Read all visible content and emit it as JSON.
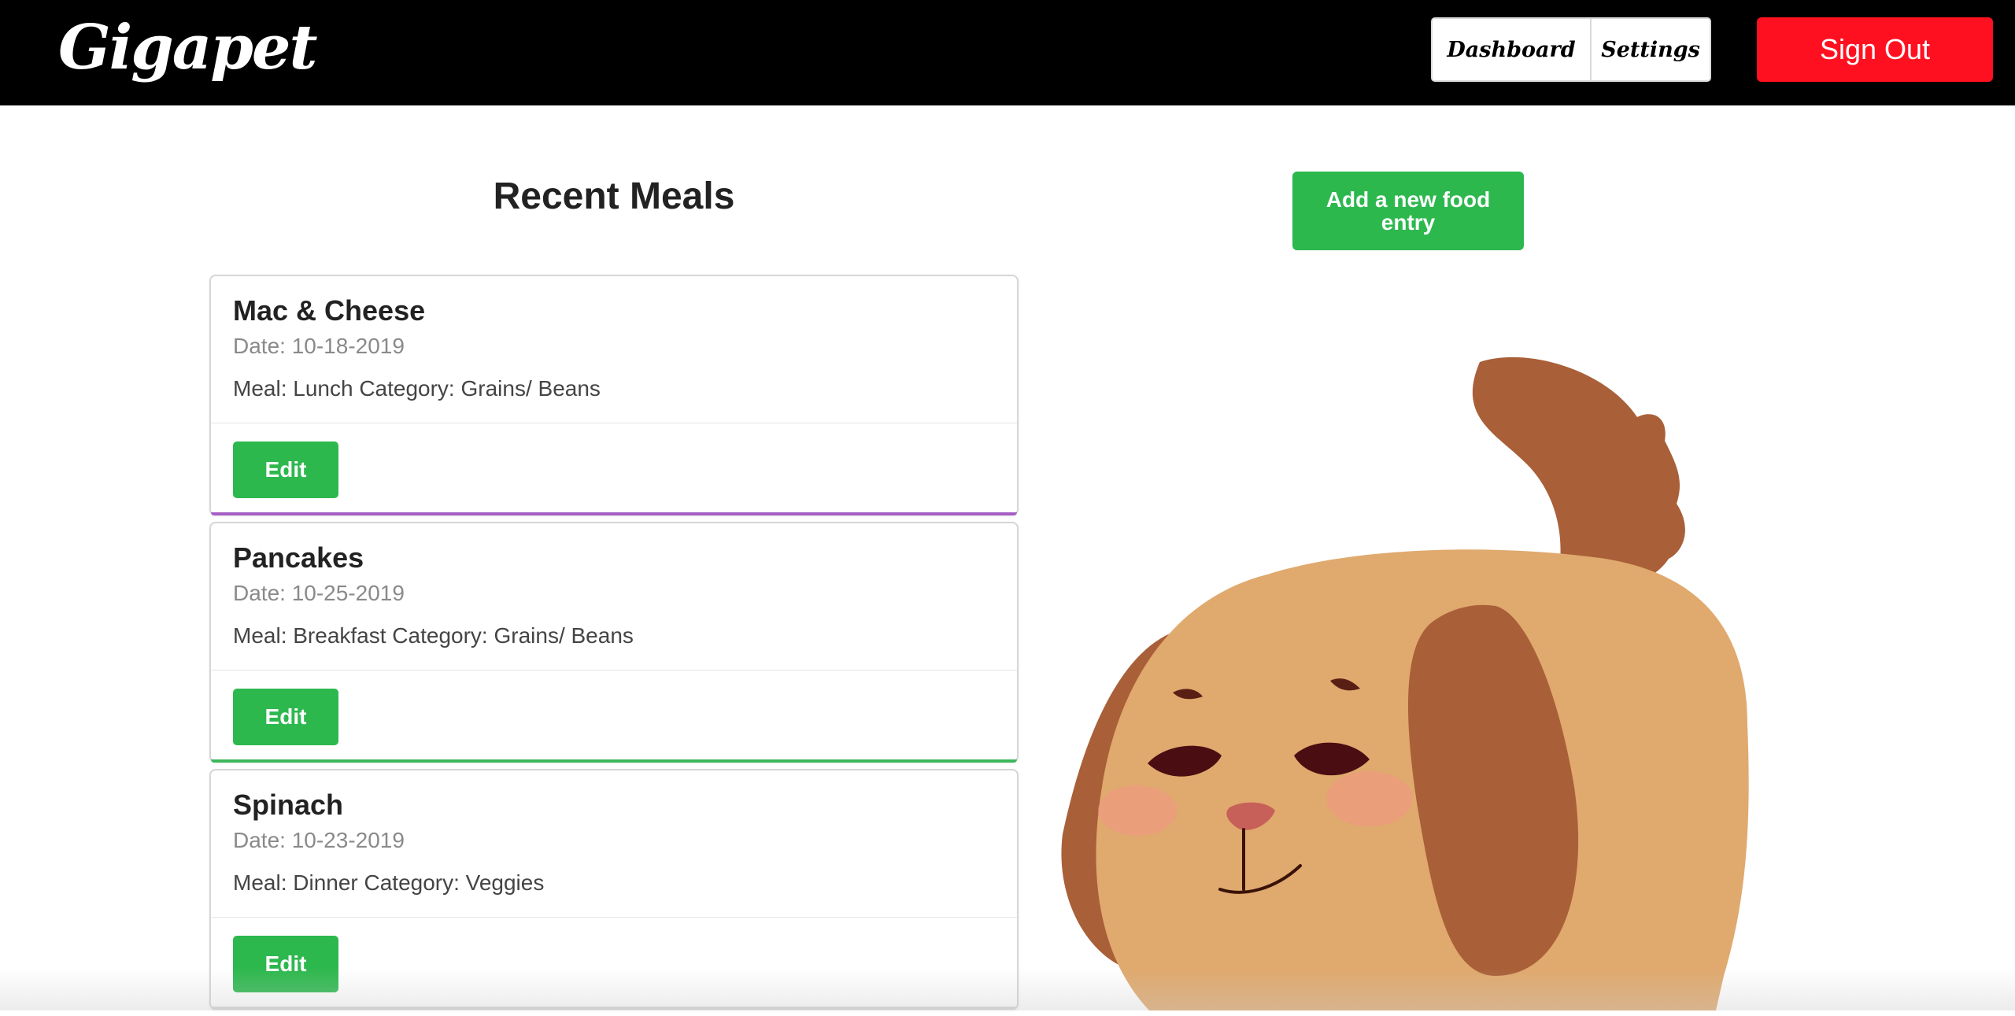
{
  "nav": {
    "brand": "Gigapet",
    "links": [
      {
        "label": "Dashboard"
      },
      {
        "label": "Settings"
      }
    ],
    "sign_out_label": "Sign Out"
  },
  "main": {
    "title": "Recent Meals",
    "add_entry_label": "Add a new food entry",
    "meals": [
      {
        "name": "Mac & Cheese",
        "date": "Date: 10-18-2019",
        "info": "Meal: Lunch Category: Grains/ Beans",
        "edit_label": "Edit",
        "accent": "#a45ec4"
      },
      {
        "name": "Pancakes",
        "date": "Date: 10-25-2019",
        "info": "Meal: Breakfast Category: Grains/ Beans",
        "edit_label": "Edit",
        "accent": "#3cb75a"
      },
      {
        "name": "Spinach",
        "date": "Date: 10-23-2019",
        "info": "Meal: Dinner Category: Veggies",
        "edit_label": "Edit",
        "accent": "#d6d6d6"
      }
    ]
  },
  "pet": {
    "icon": "dog-pet-illustration",
    "colors": {
      "body": "#e0a96e",
      "ear": "#a95f37",
      "cheek": "#f29585",
      "nose": "#c8605a"
    }
  },
  "colors": {
    "navbar": "#000000",
    "sign_out": "#ff1020",
    "primary_green": "#2db84e"
  }
}
